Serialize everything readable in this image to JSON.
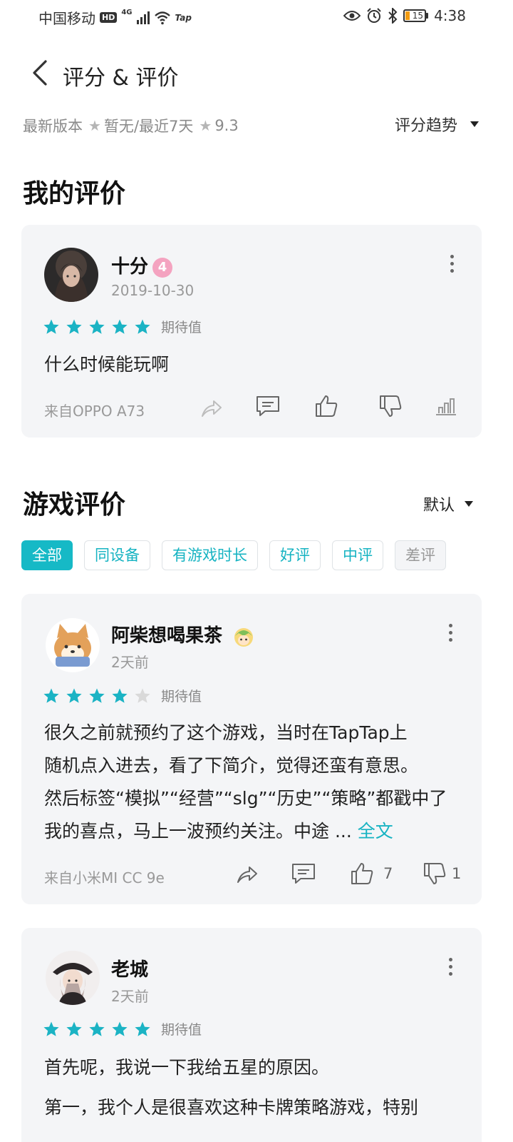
{
  "status_bar": {
    "carrier": "中国移动",
    "hd": "HD",
    "network": "4G",
    "app_badge": "Tap",
    "battery": "15",
    "time": "4:38"
  },
  "header": {
    "title": "评分 & 评价"
  },
  "summary": {
    "latest_label": "最新版本",
    "latest_value": "暂无",
    "recent_label": "/最近7天",
    "recent_value": "9.3",
    "trend_label": "评分趋势"
  },
  "my_review": {
    "section_title": "我的评价",
    "user": "十分",
    "level": "4",
    "date": "2019-10-30",
    "stars": 5,
    "star_label": "期待值",
    "text": "什么时候能玩啊",
    "device": "来自OPPO A73"
  },
  "game_reviews": {
    "section_title": "游戏评价",
    "sort_label": "默认",
    "filters": [
      "全部",
      "同设备",
      "有游戏时长",
      "好评",
      "中评",
      "差评"
    ],
    "items": [
      {
        "user": "阿柴想喝果茶",
        "time": "2天前",
        "stars": 4,
        "star_label": "期待值",
        "lines": [
          "很久之前就预约了这个游戏，当时在TapTap上",
          "随机点入进去，看了下简介，觉得还蛮有意思。",
          "然后标签“模拟”“经营”“slg”“历史”“策略”都戳中了",
          "我的喜点，马上一波预约关注。中途 ..."
        ],
        "more_link": "全文",
        "device": "来自小米MI CC 9e",
        "likes": "7",
        "dislikes": "1"
      },
      {
        "user": "老城",
        "time": "2天前",
        "stars": 5,
        "star_label": "期待值",
        "lines": [
          "首先呢，我说一下我给五星的原因。",
          "第一，我个人是很喜欢这种卡牌策略游戏，特别"
        ]
      }
    ]
  },
  "colors": {
    "accent": "#16b9c6",
    "star_active": "#1bb3c4",
    "star_inactive": "#d9d9d9"
  }
}
